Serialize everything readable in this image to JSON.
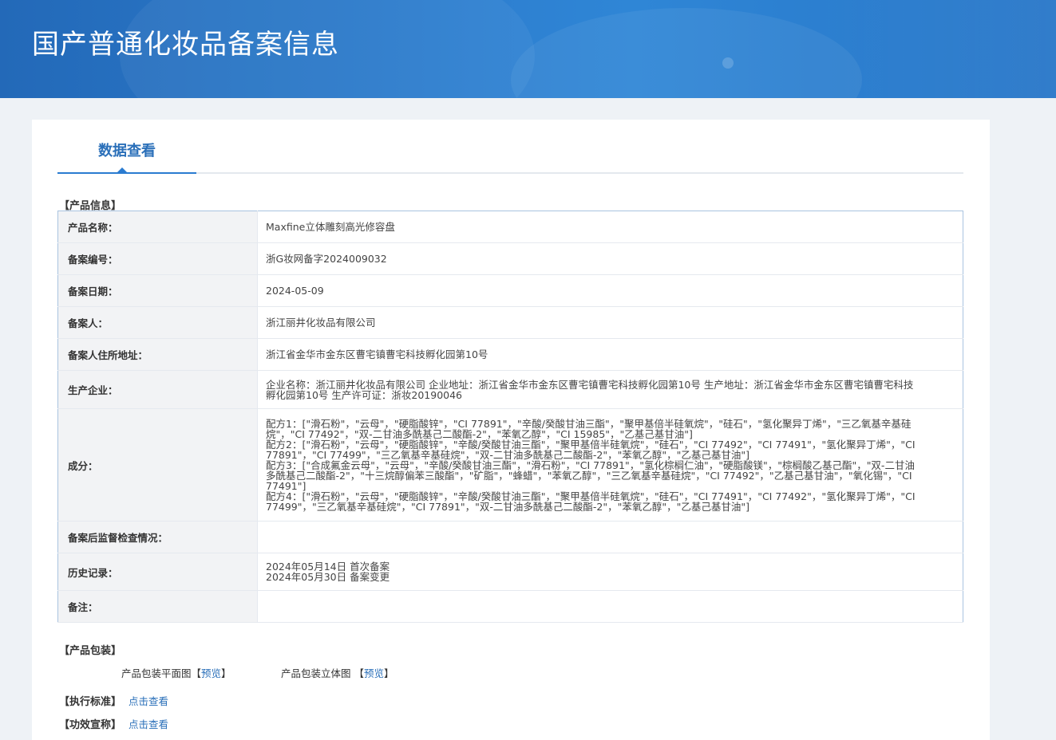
{
  "header": {
    "title": "国产普通化妆品备案信息"
  },
  "tabs": [
    {
      "label": "数据查看"
    }
  ],
  "product_section": {
    "title": "【产品信息】",
    "rows": [
      {
        "label": "产品名称：",
        "value": "Maxfine立体雕刻高光修容盘"
      },
      {
        "label": "备案编号：",
        "value": "浙G妆网备字2024009032"
      },
      {
        "label": "备案日期：",
        "value": "2024-05-09"
      },
      {
        "label": "备案人：",
        "value": "浙江丽井化妆品有限公司"
      },
      {
        "label": "备案人住所地址：",
        "value": "浙江省金华市金东区曹宅镇曹宅科技孵化园第10号"
      },
      {
        "label": "生产企业：",
        "value": "企业名称：浙江丽井化妆品有限公司 企业地址：浙江省金华市金东区曹宅镇曹宅科技孵化园第10号 生产地址：浙江省金华市金东区曹宅镇曹宅科技孵化园第10号 生产许可证：浙妆20190046"
      },
      {
        "label": "成分：",
        "lines": [
          "配方1：[\"滑石粉\"，\"云母\"，\"硬脂酸锌\"，\"CI 77891\"，\"辛酸/癸酸甘油三酯\"，\"聚甲基倍半硅氧烷\"，\"硅石\"，\"氢化聚异丁烯\"，\"三乙氧基辛基硅烷\"，\"CI 77492\"，\"双-二甘油多酰基己二酸酯-2\"，\"苯氧乙醇\"，\"CI 15985\"，\"乙基己基甘油\"]",
          "配方2：[\"滑石粉\"，\"云母\"，\"硬脂酸锌\"，\"辛酸/癸酸甘油三酯\"，\"聚甲基倍半硅氧烷\"，\"硅石\"，\"CI 77492\"，\"CI 77491\"，\"氢化聚异丁烯\"，\"CI 77891\"，\"CI 77499\"，\"三乙氧基辛基硅烷\"，\"双-二甘油多酰基己二酸酯-2\"，\"苯氧乙醇\"，\"乙基己基甘油\"]",
          "配方3：[\"合成氟金云母\"，\"云母\"，\"辛酸/癸酸甘油三酯\"，\"滑石粉\"，\"CI 77891\"，\"氢化棕榈仁油\"，\"硬脂酸镁\"，\"棕榈酸乙基己酯\"，\"双-二甘油多酰基己二酸酯-2\"，\"十三烷醇偏苯三酸酯\"，\"矿脂\"，\"蜂蜡\"，\"苯氧乙醇\"，\"三乙氧基辛基硅烷\"，\"CI 77492\"，\"乙基己基甘油\"，\"氧化锡\"，\"CI 77491\"]",
          "配方4：[\"滑石粉\"，\"云母\"，\"硬脂酸锌\"，\"辛酸/癸酸甘油三酯\"，\"聚甲基倍半硅氧烷\"，\"硅石\"，\"CI 77491\"，\"CI 77492\"，\"氢化聚异丁烯\"，\"CI 77499\"，\"三乙氧基辛基硅烷\"，\"CI 77891\"，\"双-二甘油多酰基己二酸酯-2\"，\"苯氧乙醇\"，\"乙基己基甘油\"]"
        ]
      },
      {
        "label": "备案后监督检查情况：",
        "value": ""
      },
      {
        "label": "历史记录：",
        "lines": [
          "2024年05月14日 首次备案",
          "2024年05月30日 备案变更"
        ]
      },
      {
        "label": "备注：",
        "value": ""
      }
    ]
  },
  "package_section": {
    "title": "【产品包装】",
    "flat_label": "产品包装平面图",
    "flat_link": "预览",
    "solid_label": "产品包装立体图",
    "solid_link": "预览",
    "bracket_open": "【",
    "bracket_close": "】"
  },
  "standard_section": {
    "title": "【执行标准】",
    "link": "点击查看"
  },
  "efficacy_section": {
    "title": "【功效宣称】",
    "link": "点击查看"
  }
}
